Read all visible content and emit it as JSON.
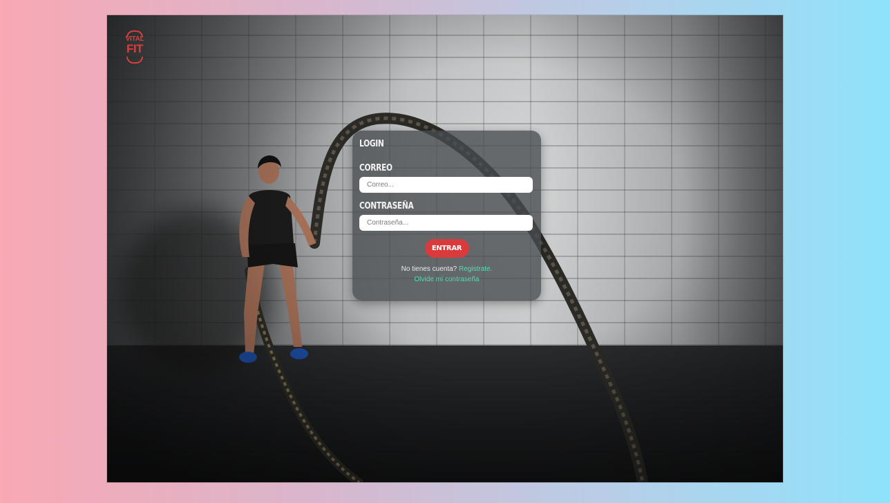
{
  "brand": {
    "logo_top": "VITAL",
    "logo_bottom": "FIT",
    "accent_color": "#d93a3c"
  },
  "login": {
    "title": "LOGIN",
    "email_label": "CORREO",
    "email_placeholder": "Correo...",
    "email_value": "",
    "password_label": "CONTRASEÑA",
    "password_placeholder": "Contraseña...",
    "password_value": "",
    "submit_label": "ENTRAR",
    "no_account_text": "No tienes cuenta?",
    "register_link": "Registrate.",
    "forgot_link": "Olvide mi contraseña",
    "link_color": "#4fe0b4"
  },
  "background": {
    "scene": "battle-ropes-photo"
  }
}
